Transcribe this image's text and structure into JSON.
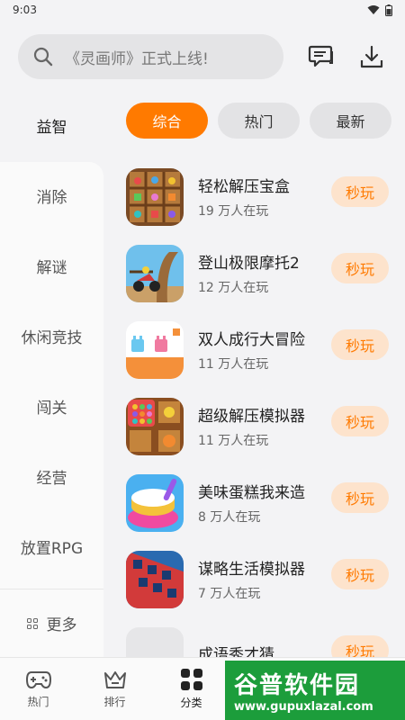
{
  "status": {
    "time": "9:03"
  },
  "search": {
    "placeholder": "《灵画师》正式上线!"
  },
  "categories": [
    {
      "label": "益智"
    },
    {
      "label": "消除"
    },
    {
      "label": "解谜"
    },
    {
      "label": "休闲竞技"
    },
    {
      "label": "闯关"
    },
    {
      "label": "经营"
    },
    {
      "label": "放置RPG"
    }
  ],
  "more_label": "更多",
  "tabs": [
    {
      "label": "综合"
    },
    {
      "label": "热门"
    },
    {
      "label": "最新"
    }
  ],
  "play_label": "秒玩",
  "games": [
    {
      "name": "轻松解压宝盒",
      "players": "19 万人在玩"
    },
    {
      "name": "登山极限摩托2",
      "players": "12 万人在玩"
    },
    {
      "name": "双人成行大冒险",
      "players": "11 万人在玩"
    },
    {
      "name": "超级解压模拟器",
      "players": "11 万人在玩"
    },
    {
      "name": "美味蛋糕我来造",
      "players": "8 万人在玩"
    },
    {
      "name": "谋略生活模拟器",
      "players": "7 万人在玩"
    },
    {
      "name": "成语秀才猜",
      "players": ""
    }
  ],
  "bottom_nav": [
    {
      "label": "热门"
    },
    {
      "label": "排行"
    },
    {
      "label": "分类"
    }
  ],
  "watermark": {
    "title": "谷普软件园",
    "url": "www.gupuxlazal.com"
  },
  "colors": {
    "accent": "#ff7a00",
    "accent_soft": "#fde3cc"
  }
}
